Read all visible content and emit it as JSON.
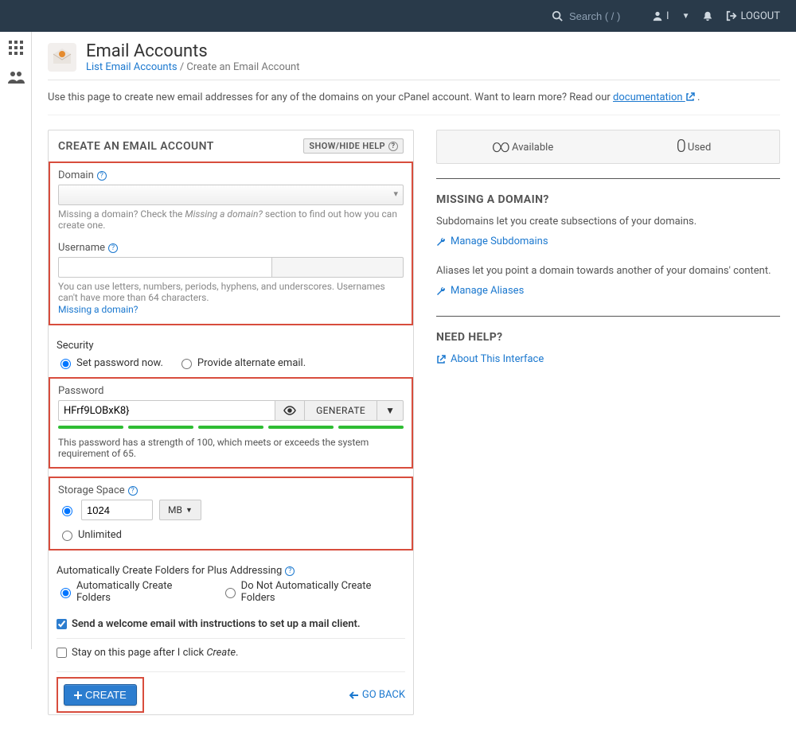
{
  "topbar": {
    "search_placeholder": "Search ( / )",
    "user_label": "I",
    "logout_label": "LOGOUT"
  },
  "page": {
    "title": "Email Accounts",
    "breadcrumb_link": "List Email Accounts",
    "breadcrumb_current": "Create an Email Account",
    "description_prefix": "Use this page to create new email addresses for any of the domains on your cPanel account. Want to learn more? Read our ",
    "documentation_label": "documentation",
    "description_suffix": " ."
  },
  "panel": {
    "heading": "CREATE AN EMAIL ACCOUNT",
    "help_button": "SHOW/HIDE HELP"
  },
  "domain_field": {
    "label": "Domain",
    "hint_1": "Missing a domain? Check the ",
    "hint_em": "Missing a domain?",
    "hint_2": " section to find out how you can create one."
  },
  "username_field": {
    "label": "Username",
    "hint": "You can use letters, numbers, periods, hyphens, and underscores. Usernames can't have more than 64 characters.",
    "missing_link": "Missing a domain?"
  },
  "security": {
    "heading": "Security",
    "radio_set_now": "Set password now.",
    "radio_alt_email": "Provide alternate email."
  },
  "password_field": {
    "label": "Password",
    "value": "HFrf9LOBxK8}",
    "generate_label": "GENERATE",
    "strength_msg": "This password has a strength of 100, which meets or exceeds the system requirement of 65."
  },
  "storage": {
    "label": "Storage Space",
    "value": "1024",
    "unit": "MB",
    "unlimited_label": "Unlimited"
  },
  "plus_addr": {
    "heading": "Automatically Create Folders for Plus Addressing",
    "radio_auto": "Automatically Create Folders",
    "radio_no_auto": "Do Not Automatically Create Folders"
  },
  "welcome_checkbox": "Send a welcome email with instructions to set up a mail client.",
  "stay_checkbox_prefix": "Stay on this page after I click ",
  "stay_checkbox_em": "Create",
  "stay_checkbox_suffix": ".",
  "create_button": "CREATE",
  "goback_label": "GO BACK",
  "stats": {
    "available_label": "Available",
    "used_num": "0",
    "used_label": "Used"
  },
  "missing_domain": {
    "heading": "MISSING A DOMAIN?",
    "sub_text": "Subdomains let you create subsections of your domains.",
    "manage_sub": "Manage Subdomains",
    "alias_text": "Aliases let you point a domain towards another of your domains' content.",
    "manage_alias": "Manage Aliases"
  },
  "need_help": {
    "heading": "NEED HELP?",
    "about_link": "About This Interface"
  }
}
